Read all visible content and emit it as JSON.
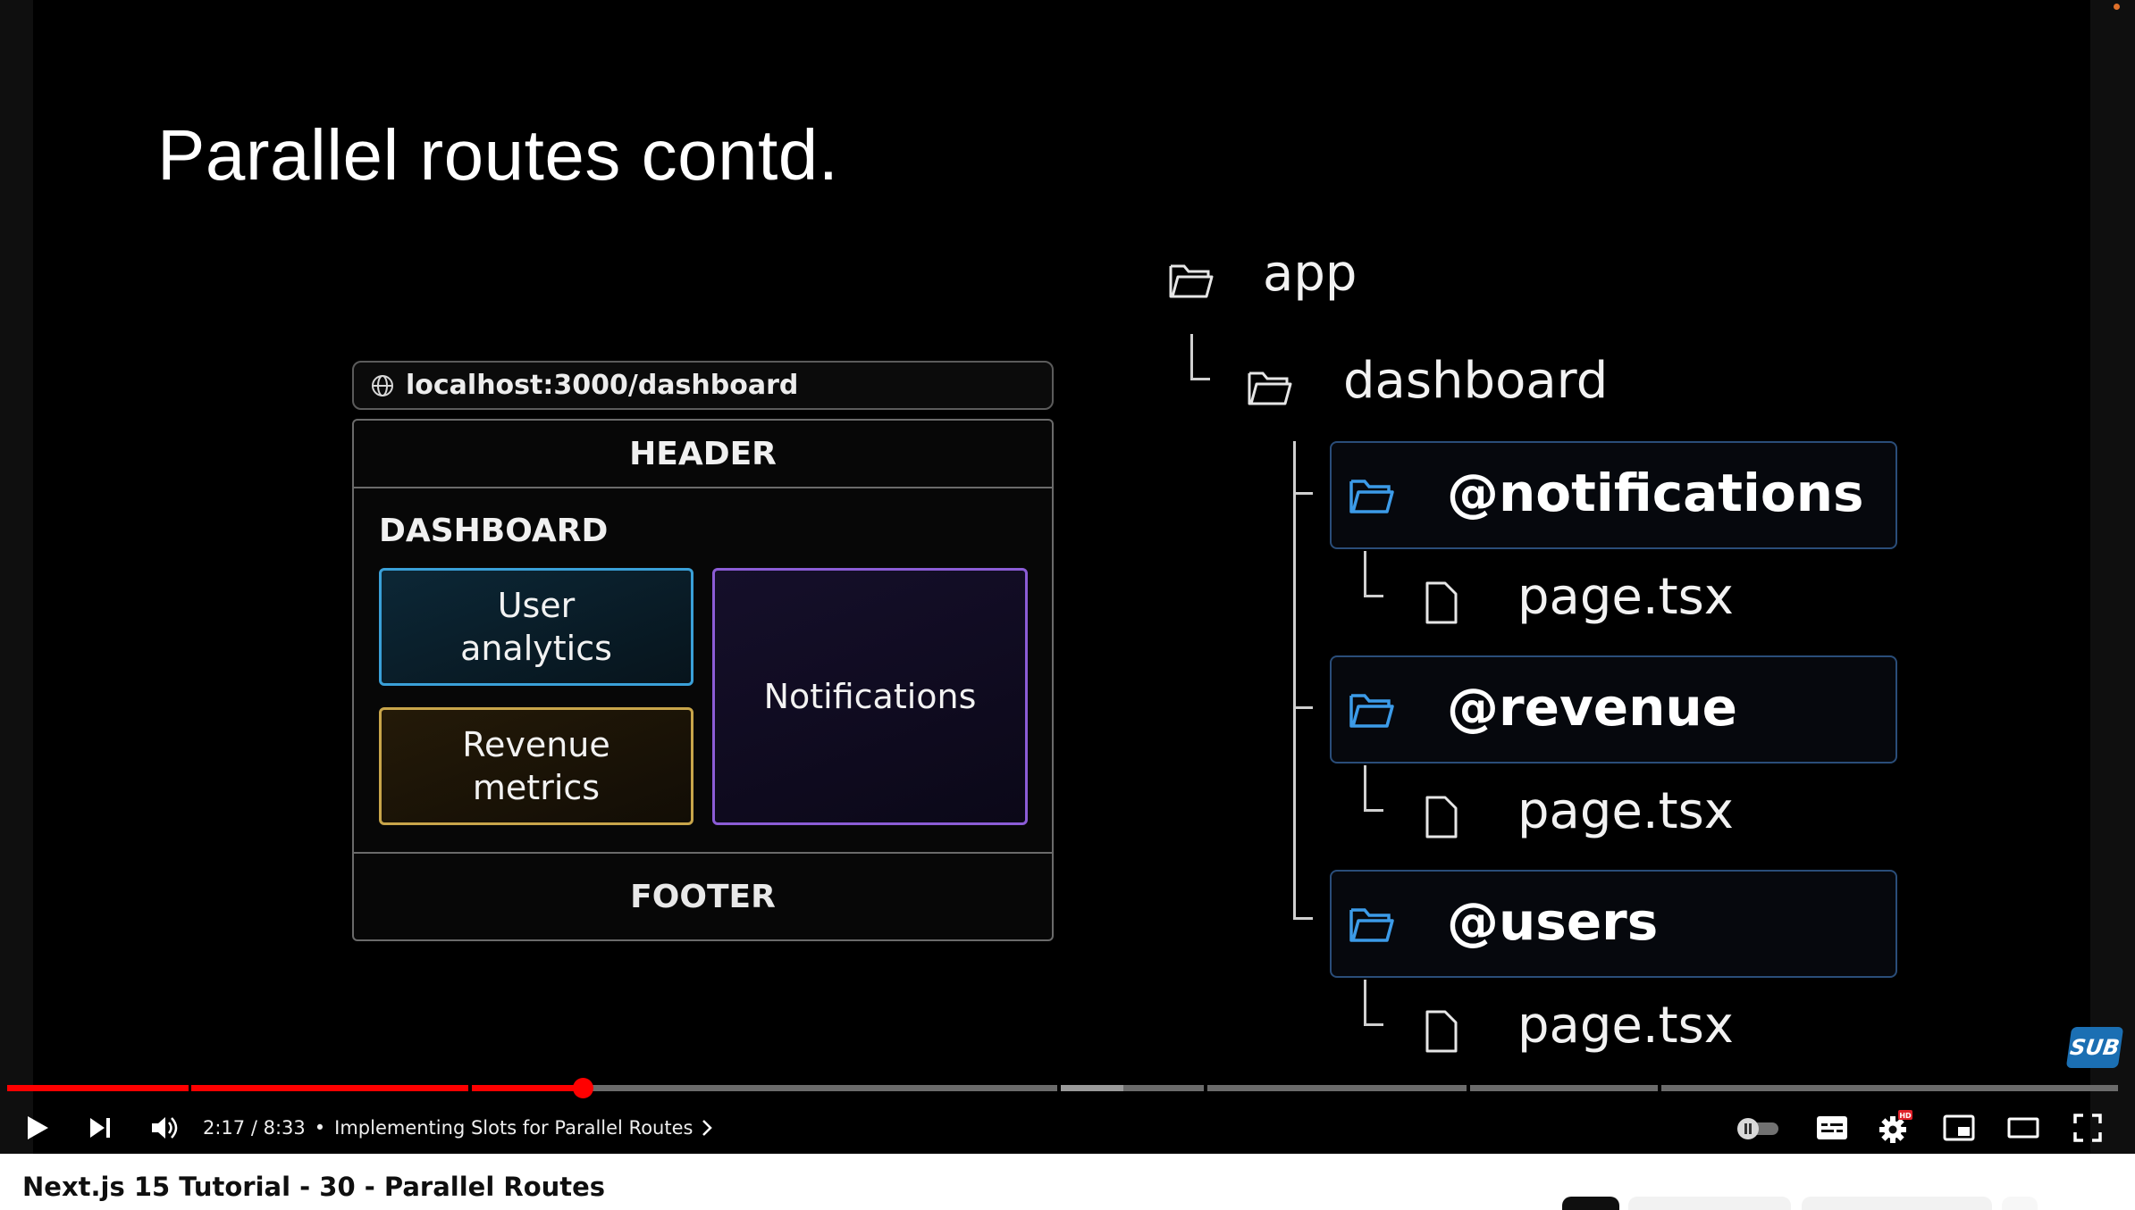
{
  "slide": {
    "title": "Parallel routes contd.",
    "browser": {
      "url": "localhost:3000/dashboard",
      "header": "HEADER",
      "dashboard": "DASHBOARD",
      "slot_users": "User analytics",
      "slot_revenue": "Revenue metrics",
      "slot_notifications": "Notifications",
      "footer": "FOOTER"
    },
    "tree": {
      "root": "app",
      "dashboard": "dashboard",
      "slots": [
        {
          "name": "@notifications",
          "file": "page.tsx"
        },
        {
          "name": "@revenue",
          "file": "page.tsx"
        },
        {
          "name": "@users",
          "file": "page.tsx"
        }
      ]
    },
    "badge": "SUB"
  },
  "player": {
    "progress_fraction": 0.2725,
    "current_time": "2:17",
    "duration": "8:33",
    "time_display": "2:17 / 8:33",
    "chapter_separator": "•",
    "chapter": "Implementing Slots for Parallel Routes",
    "colors": {
      "played": "#ff0000",
      "buffered": "#9a9a9a",
      "unplayed": "#6b6b6b"
    },
    "settings_badge": "HD",
    "icons": [
      "play-icon",
      "next-icon",
      "volume-icon",
      "autoplay-toggle-icon",
      "captions-icon",
      "settings-icon",
      "miniplayer-icon",
      "theater-icon",
      "fullscreen-icon"
    ]
  },
  "video": {
    "title": "Next.js 15 Tutorial - 30 - Parallel Routes"
  }
}
